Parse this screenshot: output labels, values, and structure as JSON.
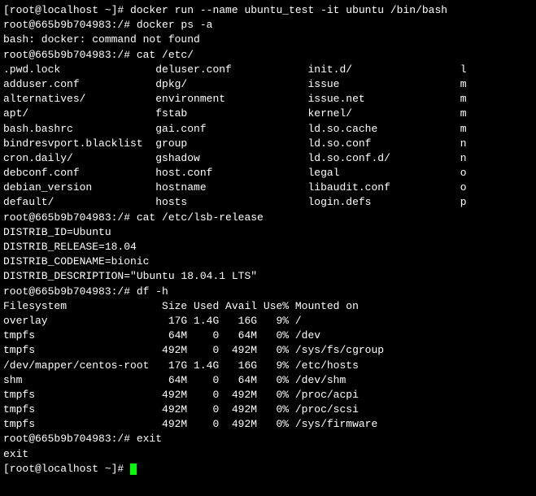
{
  "lines": [
    "[root@localhost ~]# docker run --name ubuntu_test -it ubuntu /bin/bash",
    "root@665b9b704983:/# docker ps -a",
    "bash: docker: command not found",
    "root@665b9b704983:/# cat /etc/",
    {
      "cols": [
        ".pwd.lock",
        "deluser.conf",
        "init.d/",
        "l"
      ]
    },
    {
      "cols": [
        "adduser.conf",
        "dpkg/",
        "issue",
        "m"
      ]
    },
    {
      "cols": [
        "alternatives/",
        "environment",
        "issue.net",
        "m"
      ]
    },
    {
      "cols": [
        "apt/",
        "fstab",
        "kernel/",
        "m"
      ]
    },
    {
      "cols": [
        "bash.bashrc",
        "gai.conf",
        "ld.so.cache",
        "m"
      ]
    },
    {
      "cols": [
        "bindresvport.blacklist",
        "group",
        "ld.so.conf",
        "n"
      ]
    },
    {
      "cols": [
        "cron.daily/",
        "gshadow",
        "ld.so.conf.d/",
        "n"
      ]
    },
    {
      "cols": [
        "debconf.conf",
        "host.conf",
        "legal",
        "o"
      ]
    },
    {
      "cols": [
        "debian_version",
        "hostname",
        "libaudit.conf",
        "o"
      ]
    },
    {
      "cols": [
        "default/",
        "hosts",
        "login.defs",
        "p"
      ]
    },
    "root@665b9b704983:/# cat /etc/lsb-release",
    "DISTRIB_ID=Ubuntu",
    "DISTRIB_RELEASE=18.04",
    "DISTRIB_CODENAME=bionic",
    "DISTRIB_DESCRIPTION=\"Ubuntu 18.04.1 LTS\"",
    "root@665b9b704983:/# df -h",
    {
      "df": [
        "Filesystem",
        "Size",
        "Used",
        "Avail",
        "Use%",
        "Mounted on"
      ]
    },
    {
      "df": [
        "overlay",
        "17G",
        "1.4G",
        "16G",
        "9%",
        "/"
      ]
    },
    {
      "df": [
        "tmpfs",
        "64M",
        "0",
        "64M",
        "0%",
        "/dev"
      ]
    },
    {
      "df": [
        "tmpfs",
        "492M",
        "0",
        "492M",
        "0%",
        "/sys/fs/cgroup"
      ]
    },
    {
      "df": [
        "/dev/mapper/centos-root",
        "17G",
        "1.4G",
        "16G",
        "9%",
        "/etc/hosts"
      ]
    },
    {
      "df": [
        "shm",
        "64M",
        "0",
        "64M",
        "0%",
        "/dev/shm"
      ]
    },
    {
      "df": [
        "tmpfs",
        "492M",
        "0",
        "492M",
        "0%",
        "/proc/acpi"
      ]
    },
    {
      "df": [
        "tmpfs",
        "492M",
        "0",
        "492M",
        "0%",
        "/proc/scsi"
      ]
    },
    {
      "df": [
        "tmpfs",
        "492M",
        "0",
        "492M",
        "0%",
        "/sys/firmware"
      ]
    },
    "root@665b9b704983:/# exit",
    "exit",
    {
      "prompt": "[root@localhost ~]# "
    }
  ],
  "col_widths": {
    "ls": [
      24,
      24,
      24,
      2
    ],
    "df": [
      24,
      5,
      5,
      6,
      5,
      0
    ]
  }
}
